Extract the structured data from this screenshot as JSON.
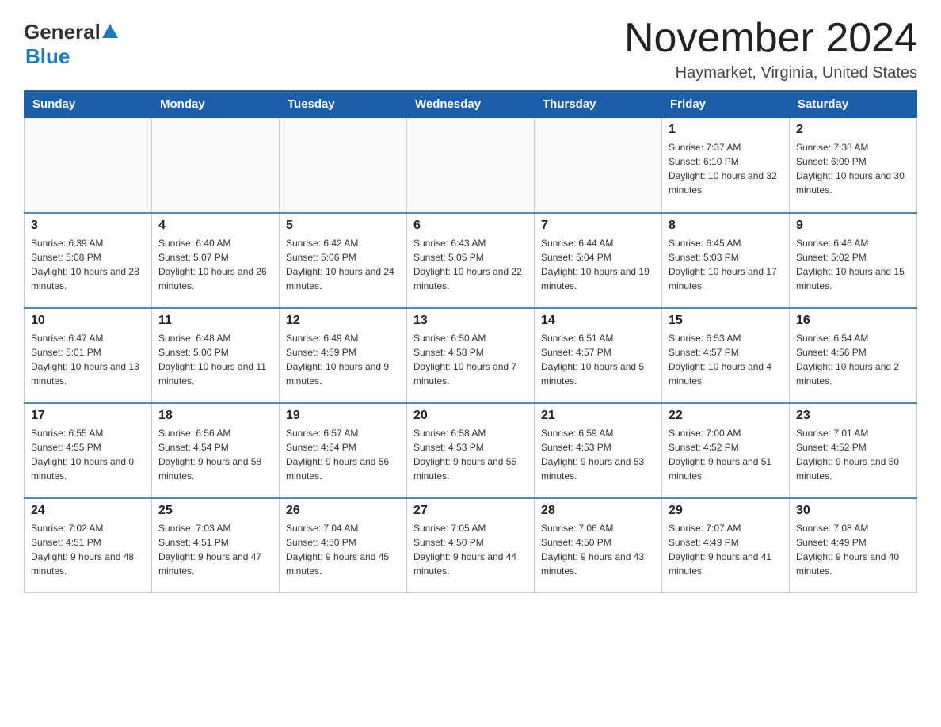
{
  "header": {
    "logo_general": "General",
    "logo_blue": "Blue",
    "main_title": "November 2024",
    "subtitle": "Haymarket, Virginia, United States"
  },
  "days_of_week": [
    "Sunday",
    "Monday",
    "Tuesday",
    "Wednesday",
    "Thursday",
    "Friday",
    "Saturday"
  ],
  "weeks": [
    [
      {
        "day": "",
        "info": ""
      },
      {
        "day": "",
        "info": ""
      },
      {
        "day": "",
        "info": ""
      },
      {
        "day": "",
        "info": ""
      },
      {
        "day": "",
        "info": ""
      },
      {
        "day": "1",
        "info": "Sunrise: 7:37 AM\nSunset: 6:10 PM\nDaylight: 10 hours and 32 minutes."
      },
      {
        "day": "2",
        "info": "Sunrise: 7:38 AM\nSunset: 6:09 PM\nDaylight: 10 hours and 30 minutes."
      }
    ],
    [
      {
        "day": "3",
        "info": "Sunrise: 6:39 AM\nSunset: 5:08 PM\nDaylight: 10 hours and 28 minutes."
      },
      {
        "day": "4",
        "info": "Sunrise: 6:40 AM\nSunset: 5:07 PM\nDaylight: 10 hours and 26 minutes."
      },
      {
        "day": "5",
        "info": "Sunrise: 6:42 AM\nSunset: 5:06 PM\nDaylight: 10 hours and 24 minutes."
      },
      {
        "day": "6",
        "info": "Sunrise: 6:43 AM\nSunset: 5:05 PM\nDaylight: 10 hours and 22 minutes."
      },
      {
        "day": "7",
        "info": "Sunrise: 6:44 AM\nSunset: 5:04 PM\nDaylight: 10 hours and 19 minutes."
      },
      {
        "day": "8",
        "info": "Sunrise: 6:45 AM\nSunset: 5:03 PM\nDaylight: 10 hours and 17 minutes."
      },
      {
        "day": "9",
        "info": "Sunrise: 6:46 AM\nSunset: 5:02 PM\nDaylight: 10 hours and 15 minutes."
      }
    ],
    [
      {
        "day": "10",
        "info": "Sunrise: 6:47 AM\nSunset: 5:01 PM\nDaylight: 10 hours and 13 minutes."
      },
      {
        "day": "11",
        "info": "Sunrise: 6:48 AM\nSunset: 5:00 PM\nDaylight: 10 hours and 11 minutes."
      },
      {
        "day": "12",
        "info": "Sunrise: 6:49 AM\nSunset: 4:59 PM\nDaylight: 10 hours and 9 minutes."
      },
      {
        "day": "13",
        "info": "Sunrise: 6:50 AM\nSunset: 4:58 PM\nDaylight: 10 hours and 7 minutes."
      },
      {
        "day": "14",
        "info": "Sunrise: 6:51 AM\nSunset: 4:57 PM\nDaylight: 10 hours and 5 minutes."
      },
      {
        "day": "15",
        "info": "Sunrise: 6:53 AM\nSunset: 4:57 PM\nDaylight: 10 hours and 4 minutes."
      },
      {
        "day": "16",
        "info": "Sunrise: 6:54 AM\nSunset: 4:56 PM\nDaylight: 10 hours and 2 minutes."
      }
    ],
    [
      {
        "day": "17",
        "info": "Sunrise: 6:55 AM\nSunset: 4:55 PM\nDaylight: 10 hours and 0 minutes."
      },
      {
        "day": "18",
        "info": "Sunrise: 6:56 AM\nSunset: 4:54 PM\nDaylight: 9 hours and 58 minutes."
      },
      {
        "day": "19",
        "info": "Sunrise: 6:57 AM\nSunset: 4:54 PM\nDaylight: 9 hours and 56 minutes."
      },
      {
        "day": "20",
        "info": "Sunrise: 6:58 AM\nSunset: 4:53 PM\nDaylight: 9 hours and 55 minutes."
      },
      {
        "day": "21",
        "info": "Sunrise: 6:59 AM\nSunset: 4:53 PM\nDaylight: 9 hours and 53 minutes."
      },
      {
        "day": "22",
        "info": "Sunrise: 7:00 AM\nSunset: 4:52 PM\nDaylight: 9 hours and 51 minutes."
      },
      {
        "day": "23",
        "info": "Sunrise: 7:01 AM\nSunset: 4:52 PM\nDaylight: 9 hours and 50 minutes."
      }
    ],
    [
      {
        "day": "24",
        "info": "Sunrise: 7:02 AM\nSunset: 4:51 PM\nDaylight: 9 hours and 48 minutes."
      },
      {
        "day": "25",
        "info": "Sunrise: 7:03 AM\nSunset: 4:51 PM\nDaylight: 9 hours and 47 minutes."
      },
      {
        "day": "26",
        "info": "Sunrise: 7:04 AM\nSunset: 4:50 PM\nDaylight: 9 hours and 45 minutes."
      },
      {
        "day": "27",
        "info": "Sunrise: 7:05 AM\nSunset: 4:50 PM\nDaylight: 9 hours and 44 minutes."
      },
      {
        "day": "28",
        "info": "Sunrise: 7:06 AM\nSunset: 4:50 PM\nDaylight: 9 hours and 43 minutes."
      },
      {
        "day": "29",
        "info": "Sunrise: 7:07 AM\nSunset: 4:49 PM\nDaylight: 9 hours and 41 minutes."
      },
      {
        "day": "30",
        "info": "Sunrise: 7:08 AM\nSunset: 4:49 PM\nDaylight: 9 hours and 40 minutes."
      }
    ]
  ]
}
